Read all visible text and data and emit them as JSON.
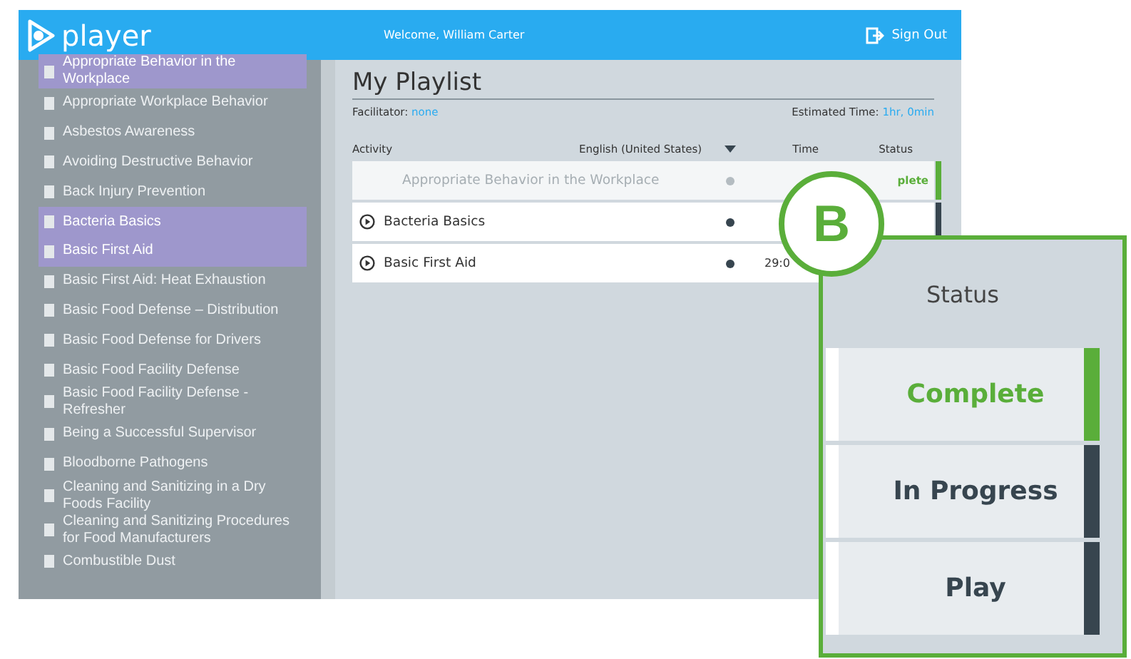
{
  "header": {
    "logo": "player",
    "welcome": "Welcome, William Carter",
    "sign_out": "Sign Out"
  },
  "sidebar": {
    "items": [
      {
        "label": "Appropriate Behavior in the Workplace",
        "selected": true
      },
      {
        "label": "Appropriate Workplace Behavior",
        "selected": false
      },
      {
        "label": "Asbestos Awareness",
        "selected": false
      },
      {
        "label": "Avoiding Destructive Behavior",
        "selected": false
      },
      {
        "label": "Back Injury Prevention",
        "selected": false
      },
      {
        "label": "Bacteria Basics",
        "selected": true
      },
      {
        "label": "Basic First Aid",
        "selected": true
      },
      {
        "label": "Basic First Aid: Heat Exhaustion",
        "selected": false
      },
      {
        "label": "Basic Food Defense – Distribution",
        "selected": false
      },
      {
        "label": "Basic Food Defense for Drivers",
        "selected": false
      },
      {
        "label": "Basic Food Facility Defense",
        "selected": false
      },
      {
        "label": "Basic Food Facility Defense - Refresher",
        "selected": false
      },
      {
        "label": "Being a Successful Supervisor",
        "selected": false
      },
      {
        "label": "Bloodborne Pathogens",
        "selected": false
      },
      {
        "label": "Cleaning and Sanitizing in a Dry Foods Facility",
        "selected": false
      },
      {
        "label": "Cleaning and Sanitizing Procedures for Food Manufacturers",
        "selected": false
      },
      {
        "label": "Combustible Dust",
        "selected": false
      }
    ]
  },
  "playlist": {
    "title": "My Playlist",
    "facilitator_label": "Facilitator:",
    "facilitator": "none",
    "estimated_label": "Estimated Time:",
    "estimated": "1hr, 0min",
    "columns": {
      "activity": "Activity",
      "language": "English (United States)",
      "time": "Time",
      "status": "Status"
    },
    "rows": [
      {
        "title": "Appropriate Behavior in the Workplace",
        "complete": true,
        "status": "plete"
      },
      {
        "title": "Bacteria Basics",
        "complete": false
      },
      {
        "title": "Basic First Aid",
        "complete": false,
        "time": "29:0"
      }
    ]
  },
  "callout": {
    "badge": "B",
    "heading": "Status",
    "items": [
      {
        "label": "Complete",
        "kind": "complete"
      },
      {
        "label": "In Progress",
        "kind": "in_progress"
      },
      {
        "label": "Play",
        "kind": "play"
      }
    ]
  }
}
